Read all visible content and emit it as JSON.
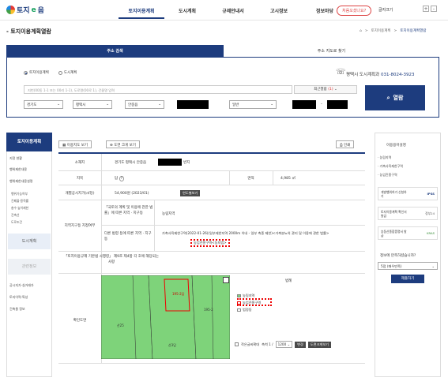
{
  "header": {
    "logo_text": "토지",
    "logo_e": "e",
    "logo_rest": "음",
    "nav": [
      "토지이용계획",
      "도시계획",
      "규제안내서",
      "고시정보",
      "정보마당"
    ],
    "first_visit": "처음오셨나요?",
    "text_size": "글자크기",
    "plus": "+",
    "minus": "-"
  },
  "page": {
    "title": "- 토지이용계획열람",
    "crumbs": [
      "토지이용계획",
      "토지이용계획열람"
    ]
  },
  "search": {
    "tabs": [
      "주소 검색",
      "주소 지도로 찾기"
    ],
    "radio": [
      "토지이용계획",
      "도시계획"
    ],
    "phone_label": "평택시 도시계획과",
    "phone_number": "031-8024-3923",
    "placeholder": "지번(00동 1-1 또는 00리 1-1), 도로명(00로 1), 건물명 입력",
    "recent": "최근열람",
    "recent_count": "(1)",
    "selects": [
      "경기도",
      "평택시",
      "안중읍",
      "",
      "일반",
      "",
      ""
    ],
    "dash": "-",
    "search_button": "열람"
  },
  "left_nav": {
    "head": "토지이용계획",
    "items": [
      "지정 현황",
      "행위제한내용",
      "행위제한내용설명"
    ],
    "subs": [
      "행위가능여부",
      "건폐율·용적률",
      "층수·높이제한",
      "건축선",
      "도로조건"
    ],
    "box1": "도시계획",
    "box2": "관련정보",
    "items2": [
      "공시지가·실거래가",
      "토지이력·특성",
      "건축물 정보"
    ]
  },
  "toolbar": {
    "map_view": "이용지도 보기",
    "big_map": "도면 크게 보기",
    "print": "인쇄"
  },
  "table": {
    "row_location_label": "소재지",
    "row_location_value": "경기도 평택시 안중읍",
    "row_location_suffix": "번지",
    "row_category_label": "지목",
    "row_category_value": "답",
    "row_area_label": "면적",
    "row_area_value": "4,985 ㎡",
    "row_price_label": "개별공시지가(㎡당)",
    "row_price_value": "54,900원 (2023/01)",
    "row_price_button": "연도별보기",
    "zone_label": "지역지구등 지정여부",
    "zone_law1": "「국토의 계획 및 이용에 관한 법률」에 따른 지역 · 지구등",
    "zone_law1_value": "농림지역",
    "zone_law2": "다른 법령 등에 따른 지역 · 지구등",
    "zone_law2_value_a": "가축사육제한구역(2022-01-26)(일부제한지역 2000m 이내 - 일부 축종 제한)<가축분뇨의 관리 및 이용에 관한 법률>",
    "zone_law2_value_b": "농업진흥구역<농지법>",
    "enforce_label": "「토지이용규제 기본법 시행령」 제9조 제4항 각 호에 해당되는 사항",
    "map_label": "확인도면",
    "legend_title": "범례",
    "legend": [
      "농림지역",
      "농업진흥구역",
      "법정동"
    ],
    "map_text": [
      "산25",
      "산26",
      "195-2답",
      "195-2",
      "산3답"
    ],
    "small_legend": "작은글씨확대",
    "scale_label": "축척 1 /",
    "scale_value": "1200",
    "change_btn": "변경",
    "enlarge_btn": "도면크게보기"
  },
  "right_nav": {
    "title": "이용용어설명",
    "links": [
      "농림지역",
      "가축사육제한구역",
      "농업진흥구역"
    ],
    "cards": [
      {
        "label": "개발행위허가 신청하기",
        "logo": "IPSS"
      },
      {
        "label": "토지이용계획 확인서 발급",
        "logo": "정부24"
      },
      {
        "label": "부동산종합증명서 발급",
        "logo": "KRAS"
      }
    ],
    "survey_q": "정보에 만족하셨습니까?",
    "survey_value": "5점 (매우만족)",
    "survey_btn": "제출하기"
  },
  "colors": {
    "primary": "#1d3c7e",
    "accent_red": "#e00000",
    "map_green": "#7ed37a"
  }
}
